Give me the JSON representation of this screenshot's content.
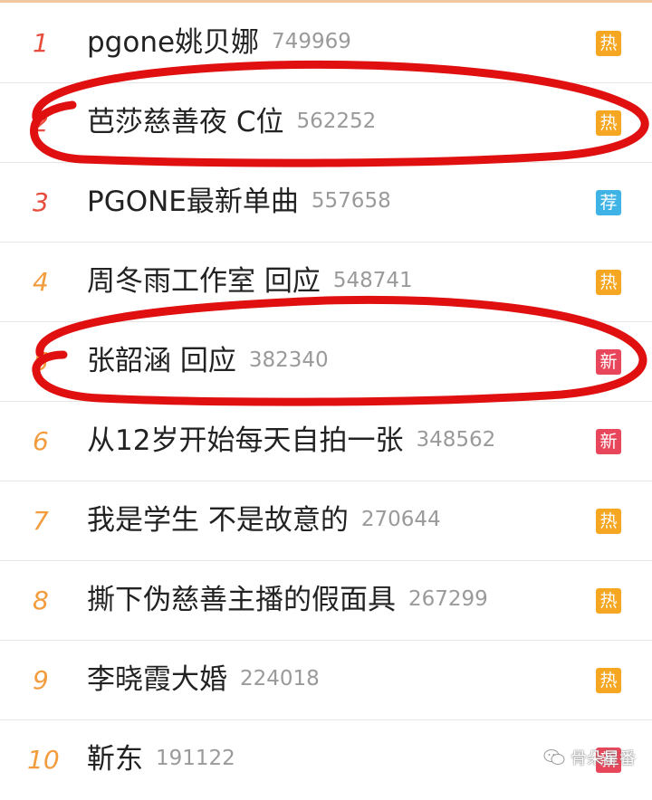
{
  "colors": {
    "hot": "#f5a623",
    "recommend": "#3fb3e6",
    "new": "#e8465a",
    "rank_top": "#e74c3c",
    "rank_mid": "#f39c3d",
    "annotation": "#e01010"
  },
  "items": [
    {
      "rank": "1",
      "title": "pgone姚贝娜",
      "count": "749969",
      "badge": "热",
      "badge_type": "hot"
    },
    {
      "rank": "2",
      "title": "芭莎慈善夜 C位",
      "count": "562252",
      "badge": "热",
      "badge_type": "hot"
    },
    {
      "rank": "3",
      "title": "PGONE最新单曲",
      "count": "557658",
      "badge": "荐",
      "badge_type": "recommend"
    },
    {
      "rank": "4",
      "title": "周冬雨工作室 回应",
      "count": "548741",
      "badge": "热",
      "badge_type": "hot"
    },
    {
      "rank": "5",
      "title": "张韶涵 回应",
      "count": "382340",
      "badge": "新",
      "badge_type": "new"
    },
    {
      "rank": "6",
      "title": "从12岁开始每天自拍一张",
      "count": "348562",
      "badge": "新",
      "badge_type": "new"
    },
    {
      "rank": "7",
      "title": "我是学生 不是故意的",
      "count": "270644",
      "badge": "热",
      "badge_type": "hot"
    },
    {
      "rank": "8",
      "title": "撕下伪慈善主播的假面具",
      "count": "267299",
      "badge": "热",
      "badge_type": "hot"
    },
    {
      "rank": "9",
      "title": "李晓霞大婚",
      "count": "224018",
      "badge": "热",
      "badge_type": "hot"
    },
    {
      "rank": "10",
      "title": "靳东",
      "count": "191122",
      "badge": "新",
      "badge_type": "new"
    }
  ],
  "watermark": {
    "text": "骨朵星番"
  }
}
